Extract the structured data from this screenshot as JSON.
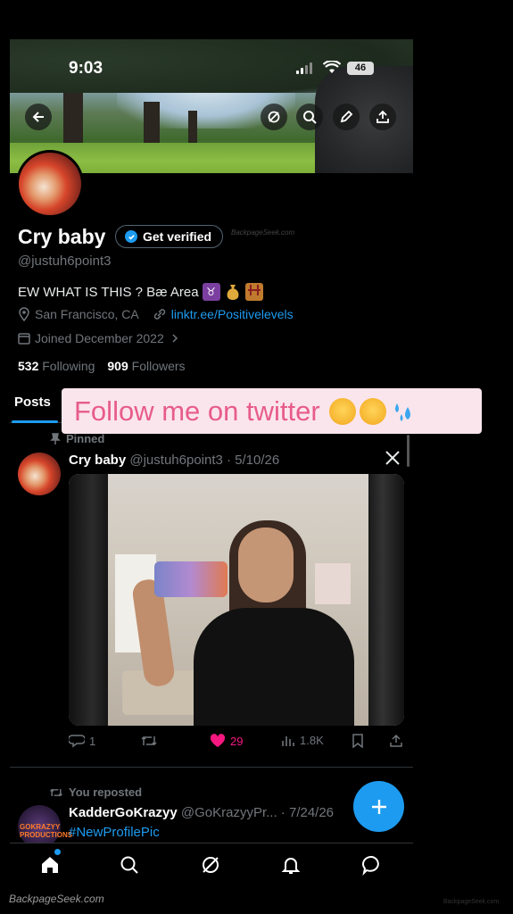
{
  "status_bar": {
    "time": "9:03",
    "battery": "46"
  },
  "profile": {
    "name": "Cry baby",
    "verify_label": "Get verified",
    "handle": "@justuh6point3",
    "bio": "EW WHAT IS THIS ? Bæ Area",
    "location": "San Francisco, CA",
    "link": "linktr.ee/Positivelevels",
    "joined": "Joined December 2022",
    "following_count": "532",
    "following_label": "Following",
    "followers_count": "909",
    "followers_label": "Followers"
  },
  "tabs": {
    "posts": "Posts"
  },
  "promo": {
    "text": "Follow me on twitter"
  },
  "pinned_post": {
    "pinned_label": "Pinned",
    "author": "Cry baby",
    "meta": "@justuh6point3 · 5/10/26",
    "replies": "1",
    "likes": "29",
    "views": "1.8K"
  },
  "repost": {
    "reposted_label": "You reposted",
    "author": "KadderGoKrazyy",
    "meta": "@GoKrazyyPr... · 7/24/26",
    "avatar_text": "GOKRAZYY PRODUCTIONS",
    "hashtag": "#NewProfilePic"
  },
  "watermarks": {
    "middle": "BackpageSeek.com",
    "bottom": "BackpageSeek.com",
    "right": "BackpageSeek.com"
  },
  "colors": {
    "accent": "#1d9bf0",
    "like": "#f91880",
    "promo_text": "#e75c8b",
    "promo_bg": "#fbe5ec"
  }
}
